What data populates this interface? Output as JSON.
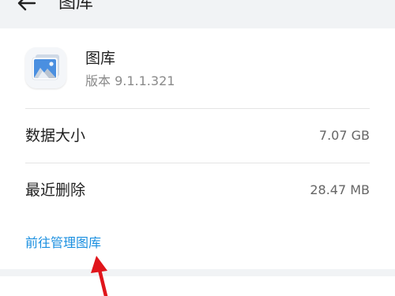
{
  "header": {
    "title": "图库",
    "back_icon": "arrow-left-icon"
  },
  "app": {
    "name": "图库",
    "version": "版本 9.1.1.321",
    "icon": "gallery-photo-icon"
  },
  "storage": {
    "rows": [
      {
        "label": "数据大小",
        "value": "7.07 GB"
      },
      {
        "label": "最近删除",
        "value": "28.47 MB"
      }
    ]
  },
  "manage_link": {
    "label": "前往管理图库",
    "color": "#1a8fe0"
  },
  "annotation": {
    "icon": "red-arrow-pointer-icon",
    "color": "#e0151b"
  }
}
